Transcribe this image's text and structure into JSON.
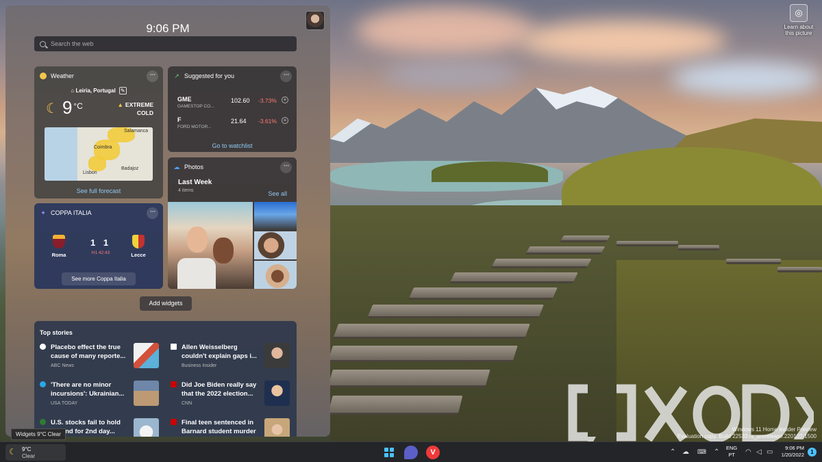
{
  "desktop": {
    "learn_label": "Learn about this picture",
    "watermark_line1": "Windows 11 Home Insider Preview",
    "watermark_line2": "Evaluation copy. Build 22533.rs_prerelease.220107-1500",
    "brand": "XDA"
  },
  "board": {
    "time": "9:06 PM",
    "search_placeholder": "Search the web"
  },
  "weather": {
    "title": "Weather",
    "location": "Leiria, Portugal",
    "temperature": "9",
    "unit": "°C",
    "alert_line1": "EXTREME",
    "alert_line2": "COLD",
    "map_cities": [
      "Salamanca",
      "Coimbra",
      "Lisbon",
      "Badajoz"
    ],
    "forecast_link": "See full forecast"
  },
  "stocks": {
    "title": "Suggested for you",
    "rows": [
      {
        "symbol": "GME",
        "name": "GAMESTOP CO...",
        "price": "102.60",
        "change": "-3.73%"
      },
      {
        "symbol": "F",
        "name": "FORD MOTOR...",
        "price": "21.64",
        "change": "-3.61%"
      }
    ],
    "watchlist_link": "Go to watchlist"
  },
  "photos": {
    "title": "Photos",
    "album": "Last Week",
    "count": "4 items",
    "see_all": "See all"
  },
  "coppa": {
    "title": "COPPA ITALIA",
    "home_team": "Roma",
    "away_team": "Lecce",
    "home_score": "1",
    "away_score": "1",
    "live_status": "H1 42:43",
    "more_link": "See more Coppa Italia"
  },
  "add_widgets_label": "Add widgets",
  "top_stories": {
    "title": "Top stories",
    "items": [
      {
        "line1": "Placebo effect the true",
        "line2": "cause of many reporte...",
        "source": "ABC News",
        "source_color": "#ffffff"
      },
      {
        "line1": "Allen Weisselberg",
        "line2": "couldn't explain gaps i...",
        "source": "Business Insider",
        "source_color": "#ffffff"
      },
      {
        "line1": "'There are no minor",
        "line2": "incursions': Ukrainian...",
        "source": "USA TODAY",
        "source_color": "#2aa7e3"
      },
      {
        "line1": "Did Joe Biden really say",
        "line2": "that the 2022 election...",
        "source": "CNN",
        "source_color": "#cc0000"
      },
      {
        "line1": "U.S. stocks fail to hold",
        "line2": "ground for 2nd day...",
        "source": "",
        "source_color": "#2e7d32"
      },
      {
        "line1": "Final teen sentenced in",
        "line2": "Barnard student murder",
        "source": "",
        "source_color": "#cc0000"
      }
    ]
  },
  "tooltip": "Widgets 9°C Clear",
  "taskbar": {
    "weather_temp": "9°C",
    "weather_cond": "Clear",
    "lang_line1": "ENG",
    "lang_line2": "PT",
    "time": "9:06 PM",
    "date": "1/20/2022",
    "notification_count": "1"
  },
  "colors": {
    "accent": "#4cc2ff",
    "link": "#8dc8f2",
    "negative": "#ff7b6e",
    "warning": "#f5c74c"
  }
}
